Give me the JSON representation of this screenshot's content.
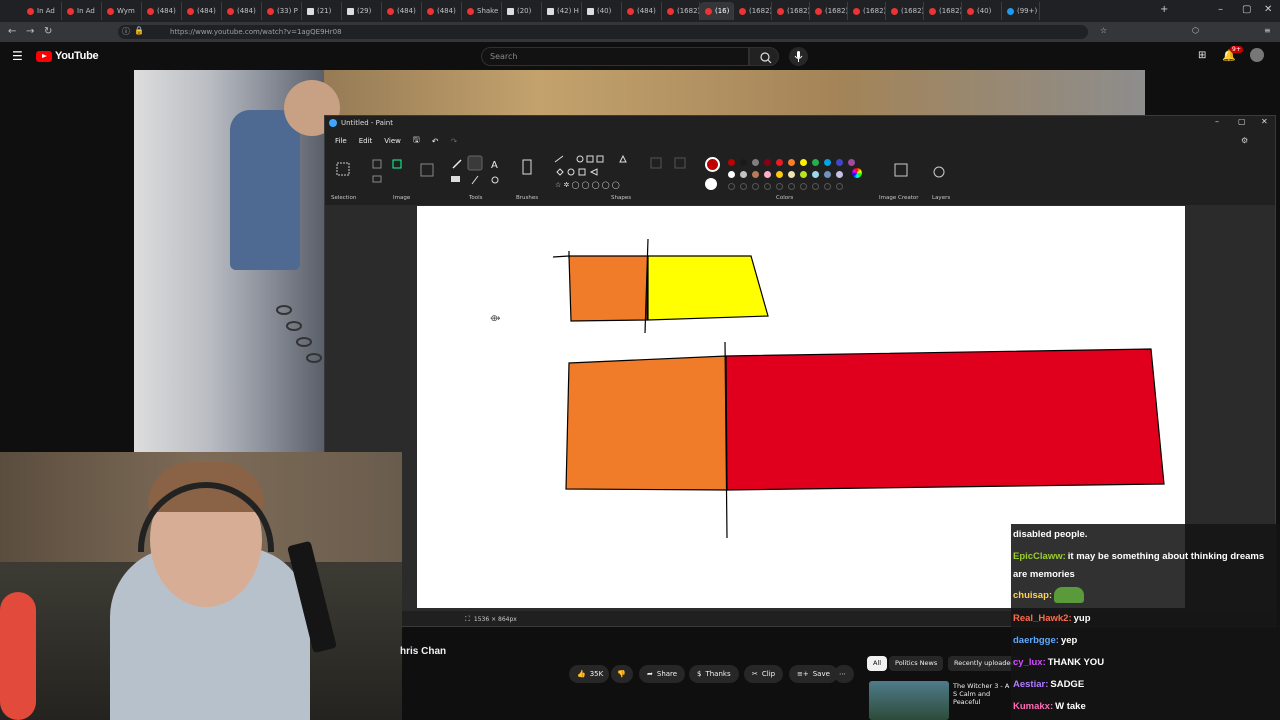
{
  "browser": {
    "tabs": [
      {
        "label": "In Ad"
      },
      {
        "label": "In Ad"
      },
      {
        "label": "Wym"
      },
      {
        "label": "(484)"
      },
      {
        "label": "(484)"
      },
      {
        "label": "(484)"
      },
      {
        "label": "(33) P"
      },
      {
        "label": "(21)"
      },
      {
        "label": "(29)"
      },
      {
        "label": "(484)"
      },
      {
        "label": "(484)"
      },
      {
        "label": "Shake"
      },
      {
        "label": "(20)"
      },
      {
        "label": "(42) H"
      },
      {
        "label": "(40)"
      },
      {
        "label": "(484)"
      },
      {
        "label": "(1682)"
      },
      {
        "label": "(16)"
      },
      {
        "label": "(1682)"
      },
      {
        "label": "(1682)"
      },
      {
        "label": "(1682)"
      },
      {
        "label": "(1682)"
      },
      {
        "label": "(1682)"
      },
      {
        "label": "(1682)"
      },
      {
        "label": "(40)"
      },
      {
        "label": "(99+)"
      }
    ],
    "url": "https://www.youtube.com/watch?v=1agQE9Hr08"
  },
  "youtube": {
    "logo_text": "YouTube",
    "search_placeholder": "Search",
    "notification_badge": "9+",
    "video_title": "hris Chan",
    "actions": {
      "like_count": "35K",
      "share": "Share",
      "thanks": "Thanks",
      "clip": "Clip",
      "save": "Save"
    },
    "chips": [
      "All",
      "Politics News",
      "Recently uploaded"
    ],
    "recommended_title": "The Witcher 3 - A S Calm and Peaceful"
  },
  "paint": {
    "window_title": "Untitled - Paint",
    "menus": [
      "File",
      "Edit",
      "View"
    ],
    "groups": {
      "selection": "Selection",
      "image": "Image",
      "tools": "Tools",
      "brushes": "Brushes",
      "shapes": "Shapes",
      "colors": "Colors",
      "image_creator": "Image Creator",
      "layers": "Layers"
    },
    "canvas_size": "1536 × 864px",
    "palette_row1": [
      "#c00000",
      "#1a1a1a",
      "#7f7f7f",
      "#880015",
      "#ed1c24",
      "#ff7f27",
      "#fff200",
      "#22b14c",
      "#00a2e8",
      "#3f48cc",
      "#a349a4"
    ],
    "palette_row2": [
      "#ffffff",
      "#c3c3c3",
      "#b97a57",
      "#ffaec9",
      "#ffc90e",
      "#efe4b0",
      "#b5e61d",
      "#99d9ea",
      "#7092be",
      "#c8bfe7"
    ],
    "drawing_colors": {
      "orange": "#f07c2a",
      "yellow": "#ffff00",
      "red": "#e0001d"
    }
  },
  "chat": {
    "messages": [
      {
        "user": "",
        "text": "disabled people.",
        "color": "#ffffff"
      },
      {
        "user": "EpicClaww:",
        "text": "it may be something about thinking dreams are memories",
        "color": "#9acd32"
      },
      {
        "user": "chuisap:",
        "text": "",
        "color": "#ffd34e",
        "emote": "frog-emote"
      },
      {
        "user": "Real_Hawk2:",
        "text": "yup",
        "color": "#ff6b4a"
      },
      {
        "user": "daerbgge:",
        "text": "yep",
        "color": "#5fa9ff"
      },
      {
        "user": "cy_lux:",
        "text": "THANK YOU",
        "color": "#d44bff"
      },
      {
        "user": "Aestiar:",
        "text": "SADGE",
        "color": "#b07cff"
      },
      {
        "user": "Kumakx:",
        "text": "W take",
        "color": "#ff69b4"
      }
    ]
  }
}
